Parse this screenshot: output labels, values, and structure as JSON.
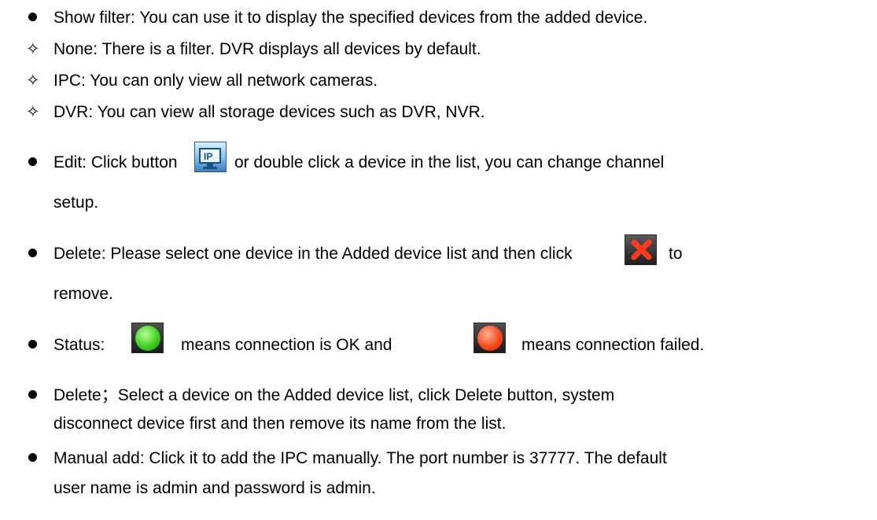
{
  "items": {
    "show_filter": "Show filter: You can use it to display the specified devices from the added device.",
    "none": "None: There is a filter. DVR displays all devices by default.",
    "ipc": "IPC: You can only view all network cameras.",
    "dvr": "DVR: You can view all storage devices such as DVR, NVR.",
    "edit_a": "Edit: Click button",
    "edit_b": "or double click a device in the list, you can change channel",
    "edit_c": "setup.",
    "delete1_a": "Delete: Please select one device in the Added device list and then click",
    "delete1_b": "to",
    "delete1_c": "remove.",
    "status_a": "Status:",
    "status_b": "means connection is OK and",
    "status_c": "means connection failed.",
    "delete2_a": "Delete；Select a device on the Added device list, click Delete button, system",
    "delete2_b": "disconnect device first and then remove its name from the list.",
    "manual_a": "Manual add: Click it to add the IPC manually. The port number is 37777. The default",
    "manual_b": "user name is admin and password is admin."
  },
  "icons": {
    "edit": "ip-edit-icon",
    "delete": "red-x-delete-icon",
    "status_ok": "green-status-light-icon",
    "status_failed": "red-status-light-icon"
  },
  "colors": {
    "status_ok": "#3ed11e",
    "status_failed": "#ff4a1a",
    "delete_x": "#ff3b1f"
  }
}
